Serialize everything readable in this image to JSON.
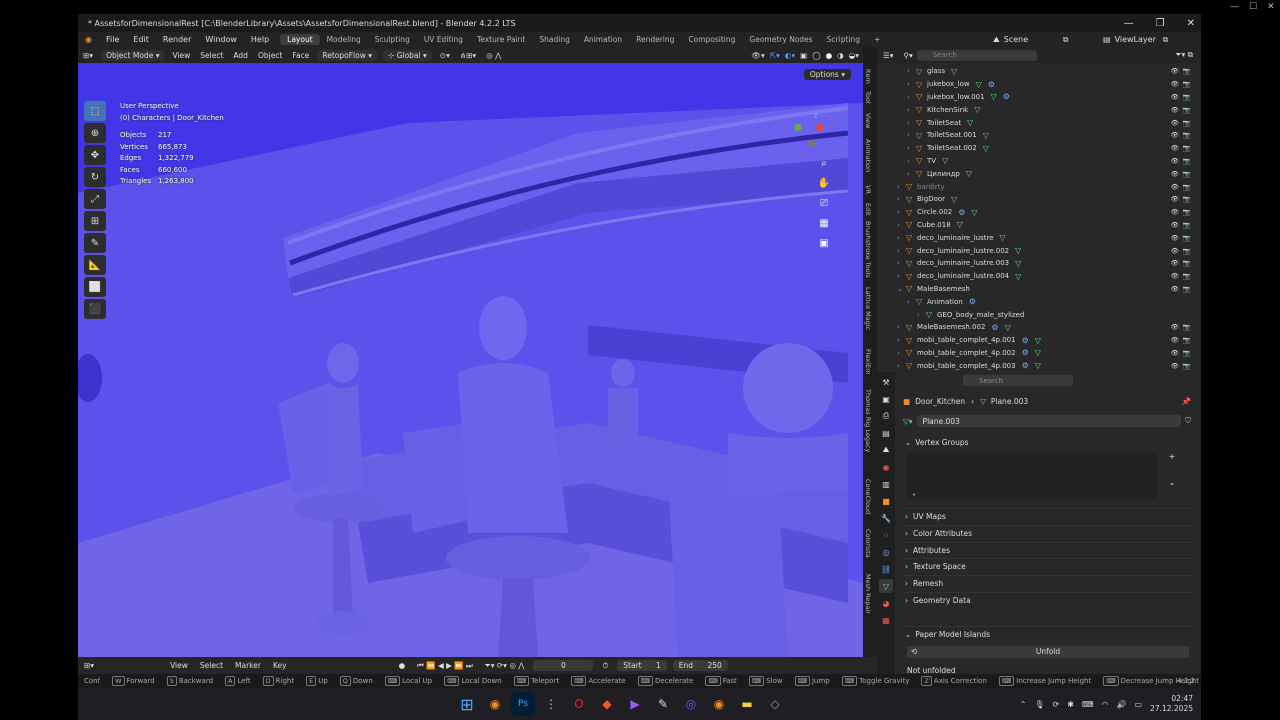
{
  "window": {
    "title": "* AssetsforDimensionalRest [C:\\BlenderLibrary\\Assets\\AssetsforDimensionalRest.blend] - Blender 4.2.2 LTS"
  },
  "menu": [
    "File",
    "Edit",
    "Render",
    "Window",
    "Help"
  ],
  "workspaces": [
    {
      "label": "Layout",
      "active": true
    },
    {
      "label": "Modeling"
    },
    {
      "label": "Sculpting"
    },
    {
      "label": "UV Editing"
    },
    {
      "label": "Texture Paint"
    },
    {
      "label": "Shading"
    },
    {
      "label": "Animation"
    },
    {
      "label": "Rendering"
    },
    {
      "label": "Compositing"
    },
    {
      "label": "Geometry Nodes"
    },
    {
      "label": "Scripting"
    }
  ],
  "topright": {
    "scene": "Scene",
    "view_layer": "ViewLayer"
  },
  "viewport_header": {
    "mode": "Object Mode",
    "items": [
      "View",
      "Select",
      "Add",
      "Object",
      "Face"
    ],
    "retopo": "RetopoFlow",
    "transform": "Global",
    "options": "Options"
  },
  "viewport_info": {
    "perspective": "User Perspective",
    "context": "(0) Characters | Door_Kitchen",
    "stats": [
      {
        "k": "Objects",
        "v": "217"
      },
      {
        "k": "Vertices",
        "v": "665,873"
      },
      {
        "k": "Edges",
        "v": "1,322,779"
      },
      {
        "k": "Faces",
        "v": "660,600"
      },
      {
        "k": "Triangles",
        "v": "1,263,800"
      }
    ]
  },
  "side_tabs": [
    "Item",
    "Tool",
    "View",
    "Animation",
    "VR",
    "Edit",
    "Brushstroke Tools",
    "Lattice Magic",
    "FlexiEm",
    "Thomas Rig Legacy",
    "ConeCloud",
    "Colorista",
    "Mesh Repair"
  ],
  "gizmo": {
    "z": "Z"
  },
  "outliner": {
    "search_placeholder": "Search",
    "rows": [
      {
        "indent": 2,
        "name": "glass",
        "icons": [
          "mesh"
        ]
      },
      {
        "indent": 2,
        "name": "jukebox_low",
        "icons": [
          "mesh",
          "mod"
        ]
      },
      {
        "indent": 2,
        "name": "jukebox_low.001",
        "icons": [
          "mesh",
          "mod"
        ]
      },
      {
        "indent": 2,
        "name": "KitchenSink",
        "icons": [
          "mesh"
        ]
      },
      {
        "indent": 2,
        "name": "ToiletSeat",
        "icons": [
          "mesh"
        ]
      },
      {
        "indent": 2,
        "name": "ToiletSeat.001",
        "icons": [
          "mesh"
        ]
      },
      {
        "indent": 2,
        "name": "ToiletSeat.002",
        "icons": [
          "mesh"
        ]
      },
      {
        "indent": 2,
        "name": "TV",
        "icons": [
          "mesh"
        ]
      },
      {
        "indent": 2,
        "name": "Цилиндр",
        "icons": [
          "mesh"
        ]
      },
      {
        "indent": 1,
        "name": "bardirty",
        "icons": [],
        "dim": true
      },
      {
        "indent": 1,
        "name": "BigDoor",
        "icons": [
          "mesh"
        ]
      },
      {
        "indent": 1,
        "name": "Circle.002",
        "icons": [
          "mod",
          "mesh"
        ]
      },
      {
        "indent": 1,
        "name": "Cube.018",
        "icons": [
          "mesh"
        ]
      },
      {
        "indent": 1,
        "name": "deco_luminaire_lustre",
        "icons": [
          "mesh"
        ]
      },
      {
        "indent": 1,
        "name": "deco_luminaire_lustre.002",
        "icons": [
          "mesh"
        ]
      },
      {
        "indent": 1,
        "name": "deco_luminaire_lustre.003",
        "icons": [
          "mesh"
        ]
      },
      {
        "indent": 1,
        "name": "deco_luminaire_lustre.004",
        "icons": [
          "mesh"
        ]
      },
      {
        "indent": 1,
        "name": "MaleBasemesh",
        "icons": [],
        "expanded": true
      },
      {
        "indent": 2,
        "name": "Animation",
        "icons": [
          "mod"
        ],
        "noeye": true
      },
      {
        "indent": 3,
        "name": "GEO_body_male_stylized",
        "icons": [],
        "noeye": true
      },
      {
        "indent": 1,
        "name": "MaleBasemesh.002",
        "icons": [
          "mod",
          "mesh"
        ]
      },
      {
        "indent": 1,
        "name": "mobi_table_complet_4p.001",
        "icons": [
          "mod",
          "mesh"
        ]
      },
      {
        "indent": 1,
        "name": "mobi_table_complet_4p.002",
        "icons": [
          "mod",
          "mesh"
        ]
      },
      {
        "indent": 1,
        "name": "mobi_table_complet_4p.003",
        "icons": [
          "mod",
          "mesh"
        ]
      }
    ]
  },
  "properties": {
    "search_placeholder": "Search",
    "breadcrumb_obj": "Door_Kitchen",
    "breadcrumb_mesh": "Plane.003",
    "mesh_name": "Plane.003",
    "vertex_groups": "Vertex Groups",
    "panels": [
      "UV Maps",
      "Color Attributes",
      "Attributes",
      "Texture Space",
      "Remesh",
      "Geometry Data"
    ],
    "paper_model": "Paper Model Islands",
    "unfold": "Unfold",
    "not_unfolded": "Not unfolded"
  },
  "timeline": {
    "items": [
      "View",
      "Select",
      "Marker",
      "Key"
    ],
    "frame": "0",
    "start_label": "Start",
    "start": "1",
    "end_label": "End",
    "end": "250"
  },
  "statusbar": [
    {
      "k": "W",
      "t": "Forward"
    },
    {
      "k": "S",
      "t": "Backward"
    },
    {
      "k": "A",
      "t": "Left"
    },
    {
      "k": "D",
      "t": "Right"
    },
    {
      "k": "E",
      "t": "Up"
    },
    {
      "k": "Q",
      "t": "Down"
    },
    {
      "k": "",
      "t": "Local Up"
    },
    {
      "k": "",
      "t": "Local Down"
    },
    {
      "k": "",
      "t": "Teleport"
    },
    {
      "k": "",
      "t": "Accelerate"
    },
    {
      "k": "",
      "t": "Decelerate"
    },
    {
      "k": "",
      "t": "Fast"
    },
    {
      "k": "",
      "t": "Slow"
    },
    {
      "k": "",
      "t": "Jump"
    },
    {
      "k": "",
      "t": "Toggle Gravity"
    },
    {
      "k": "Z",
      "t": "Axis Correction"
    },
    {
      "k": "",
      "t": "Increase Jump Height"
    },
    {
      "k": "",
      "t": "Decrease Jump Height"
    }
  ],
  "status_version": "4.2.2",
  "statusbar_lead": "Conf",
  "taskbar": {
    "icons": [
      "windows-icon",
      "blender-icon",
      "photoshop-icon",
      "tool-icon",
      "opera-icon",
      "brave-icon",
      "video-editor-icon",
      "editor-icon",
      "discord-icon",
      "blender-icon-2",
      "files-icon",
      "app-icon"
    ],
    "time": "02:47",
    "date": "27.12.2025"
  },
  "colors": {
    "viewport": "#5a52ea",
    "accent": "#4772b3",
    "object_icon": "#f28d2e",
    "mesh_icon": "#5ee07d"
  }
}
